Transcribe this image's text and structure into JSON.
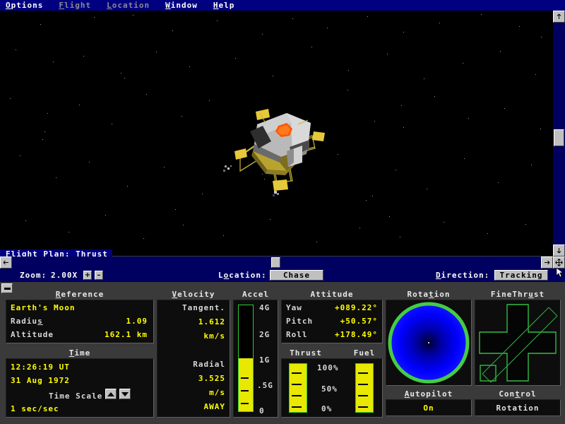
{
  "menu": {
    "items": [
      {
        "label": "Options",
        "accel": "O",
        "disabled": false
      },
      {
        "label": "Flight",
        "accel": "F",
        "disabled": true
      },
      {
        "label": "Location",
        "accel": "L",
        "disabled": true
      },
      {
        "label": "Window",
        "accel": "W",
        "disabled": false
      },
      {
        "label": "Help",
        "accel": "H",
        "disabled": false
      }
    ]
  },
  "viewport": {
    "flight_plan_label": "Flight Plan:  Thrust",
    "craft_name": "lunar-module"
  },
  "control_strip": {
    "zoom_label": "Zoom:",
    "zoom_value": "2.00X",
    "zoom_in": "+",
    "zoom_out": "–",
    "location_label": "Location:",
    "location_value": "Chase",
    "direction_label": "Direction:",
    "direction_value": "Tracking"
  },
  "panel": {
    "reference": {
      "title": "Reference",
      "body_name": "Earth's Moon",
      "radius_label": "Radius",
      "radius_value": "1.09",
      "altitude_label": "Altitude",
      "altitude_value": "162.1 km"
    },
    "time": {
      "title": "Time",
      "clock": "12:26:19 UT",
      "date": "31 Aug 1972",
      "scale_label": "Time Scale",
      "scale_value": "1 sec/sec"
    },
    "velocity": {
      "title": "Velocity",
      "tangent_label": "Tangent.",
      "tangent_value": "1.612",
      "tangent_unit": "km/s",
      "radial_label": "Radial",
      "radial_value": "3.525",
      "radial_unit": "m/s",
      "radial_dir": "AWAY"
    },
    "accel": {
      "title": "Accel",
      "scale": [
        "4G",
        "2G",
        "1G",
        ".5G",
        "0"
      ],
      "fill_percent": 50
    },
    "attitude": {
      "title": "Attitude",
      "rows": [
        {
          "label": "Yaw",
          "value": "+089.22°"
        },
        {
          "label": "Pitch",
          "value": "+50.57°"
        },
        {
          "label": "Roll",
          "value": "+178.49°"
        }
      ]
    },
    "thrust": {
      "title": "Thrust",
      "fill_percent": 100
    },
    "fuel": {
      "title": "Fuel",
      "fill_percent": 100
    },
    "thrust_scale": [
      "100%",
      "50%",
      "0%"
    ],
    "rotation": {
      "title": "Rotation"
    },
    "finethrust": {
      "title": "FineThrust"
    },
    "autopilot": {
      "title": "Autopilot",
      "value": "On"
    },
    "control": {
      "title": "Control",
      "value": "Rotation"
    }
  },
  "colors": {
    "menu_bar": "#000080",
    "panel_bg": "#3a3a3a",
    "readout_bg": "#0d0d0d",
    "value_yellow": "#ffff00",
    "gauge_green": "#33cc33",
    "gauge_yellow": "#e8e800",
    "sphere_blue": "#0000ff"
  }
}
